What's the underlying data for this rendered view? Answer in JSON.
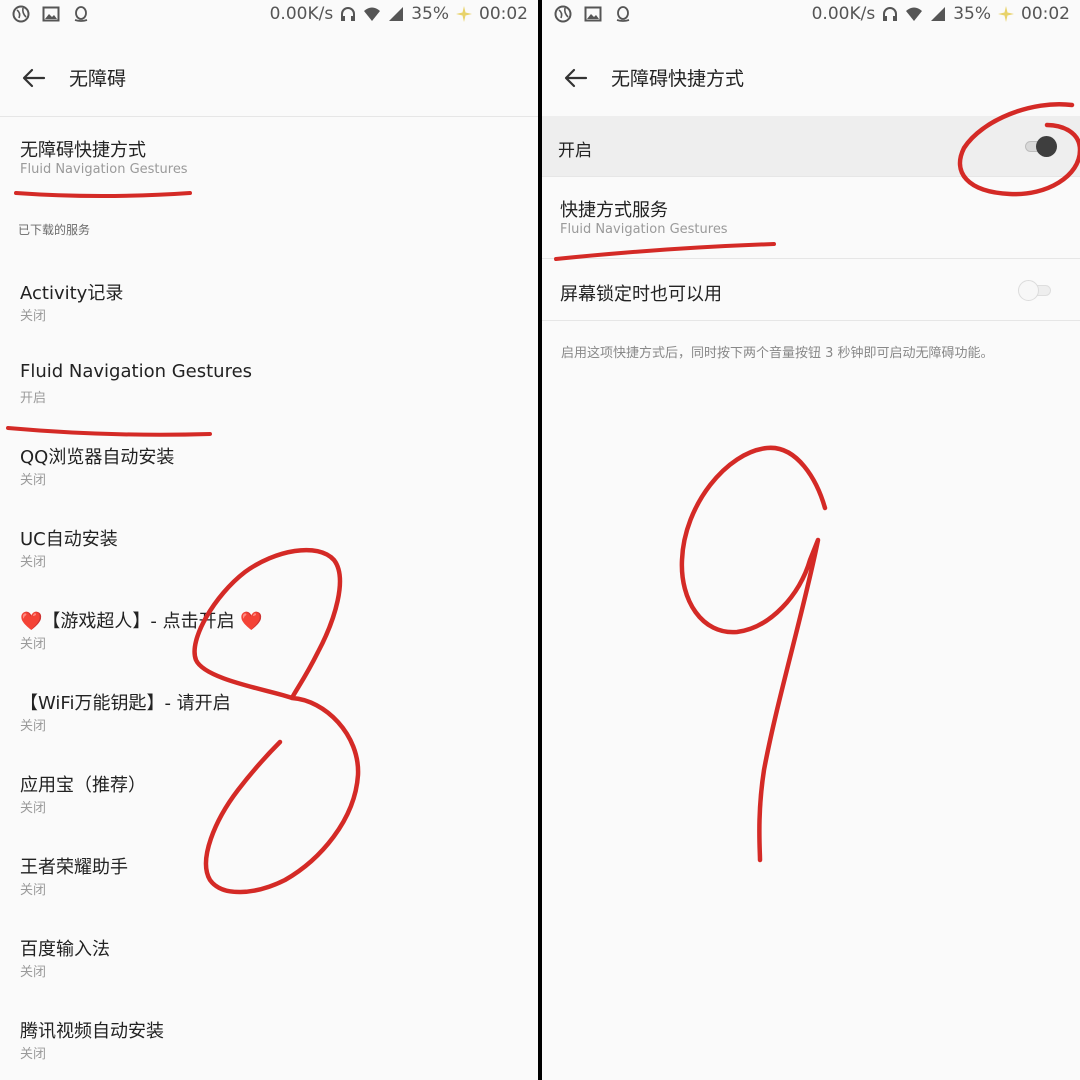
{
  "status_bar": {
    "network_speed": "0.00K/s",
    "battery_percent": "35%",
    "time": "00:02"
  },
  "left": {
    "title": "无障碍",
    "shortcut_item": {
      "title": "无障碍快捷方式",
      "subtitle": "Fluid Navigation Gestures"
    },
    "section_header": "已下载的服务",
    "services": [
      {
        "title": "Activity记录",
        "status": "关闭"
      },
      {
        "title": "Fluid Navigation Gestures",
        "status": "开启"
      },
      {
        "title": "QQ浏览器自动安装",
        "status": "关闭"
      },
      {
        "title": "UC自动安装",
        "status": "关闭"
      },
      {
        "title": "❤️【游戏超人】- 点击开启 ❤️",
        "status": "关闭"
      },
      {
        "title": "【WiFi万能钥匙】- 请开启",
        "status": "关闭"
      },
      {
        "title": "应用宝（推荐）",
        "status": "关闭"
      },
      {
        "title": "王者荣耀助手",
        "status": "关闭"
      },
      {
        "title": "百度输入法",
        "status": "关闭"
      },
      {
        "title": "腾讯视频自动安装",
        "status": "关闭"
      }
    ]
  },
  "right": {
    "title": "无障碍快捷方式",
    "main_switch": {
      "label": "开启",
      "checked": true
    },
    "shortcut_service": {
      "title": "快捷方式服务",
      "subtitle": "Fluid Navigation Gestures"
    },
    "lock_screen": {
      "label": "屏幕锁定时也可以用",
      "checked": false
    },
    "hint": "启用这项快捷方式后，同时按下两个音量按钮 3 秒钟即可启动无障碍功能。"
  },
  "annotations": {
    "left_digit": "8",
    "right_digit": "9",
    "ink_color": "#d42a26"
  },
  "colors": {
    "background": "#fafafa",
    "divider": "#e6e6e6",
    "toggle_knob_on": "#3e3e3e"
  }
}
